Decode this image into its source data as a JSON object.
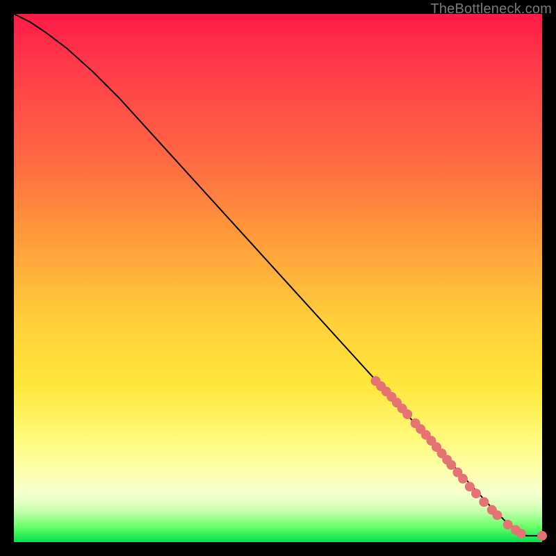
{
  "watermark": "TheBottleneck.com",
  "colors": {
    "curve_stroke": "#000000",
    "marker_fill": "#e57373",
    "marker_stroke": "#d96a6a"
  },
  "chart_data": {
    "type": "line",
    "title": "",
    "xlabel": "",
    "ylabel": "",
    "xlim": [
      0,
      100
    ],
    "ylim": [
      0,
      100
    ],
    "grid": false,
    "legend": false,
    "series": [
      {
        "name": "curve",
        "x": [
          0,
          3,
          6,
          10,
          15,
          20,
          25,
          30,
          35,
          40,
          45,
          50,
          55,
          60,
          65,
          70,
          75,
          80,
          85,
          90,
          93,
          95,
          97,
          100
        ],
        "y": [
          100,
          98.5,
          96.5,
          93.5,
          89,
          84,
          78.5,
          73,
          67.5,
          62,
          56.5,
          51,
          45.5,
          40,
          34.5,
          29,
          23.5,
          18,
          12.5,
          7,
          4,
          2.5,
          1.2,
          1.2
        ]
      }
    ],
    "markers": [
      {
        "x": 68.5,
        "y": 30.5
      },
      {
        "x": 69.5,
        "y": 29.5
      },
      {
        "x": 70.5,
        "y": 28.5
      },
      {
        "x": 71.5,
        "y": 27.5
      },
      {
        "x": 72.5,
        "y": 26.4
      },
      {
        "x": 73.5,
        "y": 25.3
      },
      {
        "x": 74.5,
        "y": 24.2
      },
      {
        "x": 76.0,
        "y": 22.5
      },
      {
        "x": 77.0,
        "y": 21.4
      },
      {
        "x": 78.0,
        "y": 20.3
      },
      {
        "x": 79.0,
        "y": 19.2
      },
      {
        "x": 80.0,
        "y": 18.0
      },
      {
        "x": 81.0,
        "y": 16.8
      },
      {
        "x": 82.0,
        "y": 15.6
      },
      {
        "x": 82.8,
        "y": 14.6
      },
      {
        "x": 84.0,
        "y": 13.2
      },
      {
        "x": 85.0,
        "y": 12.0
      },
      {
        "x": 86.3,
        "y": 10.5
      },
      {
        "x": 87.5,
        "y": 9.2
      },
      {
        "x": 89.0,
        "y": 7.6
      },
      {
        "x": 90.5,
        "y": 6.1
      },
      {
        "x": 91.5,
        "y": 5.1
      },
      {
        "x": 93.5,
        "y": 3.3
      },
      {
        "x": 95.0,
        "y": 2.3
      },
      {
        "x": 96.0,
        "y": 1.6
      },
      {
        "x": 100.0,
        "y": 1.2
      }
    ],
    "marker_radius": 7
  }
}
